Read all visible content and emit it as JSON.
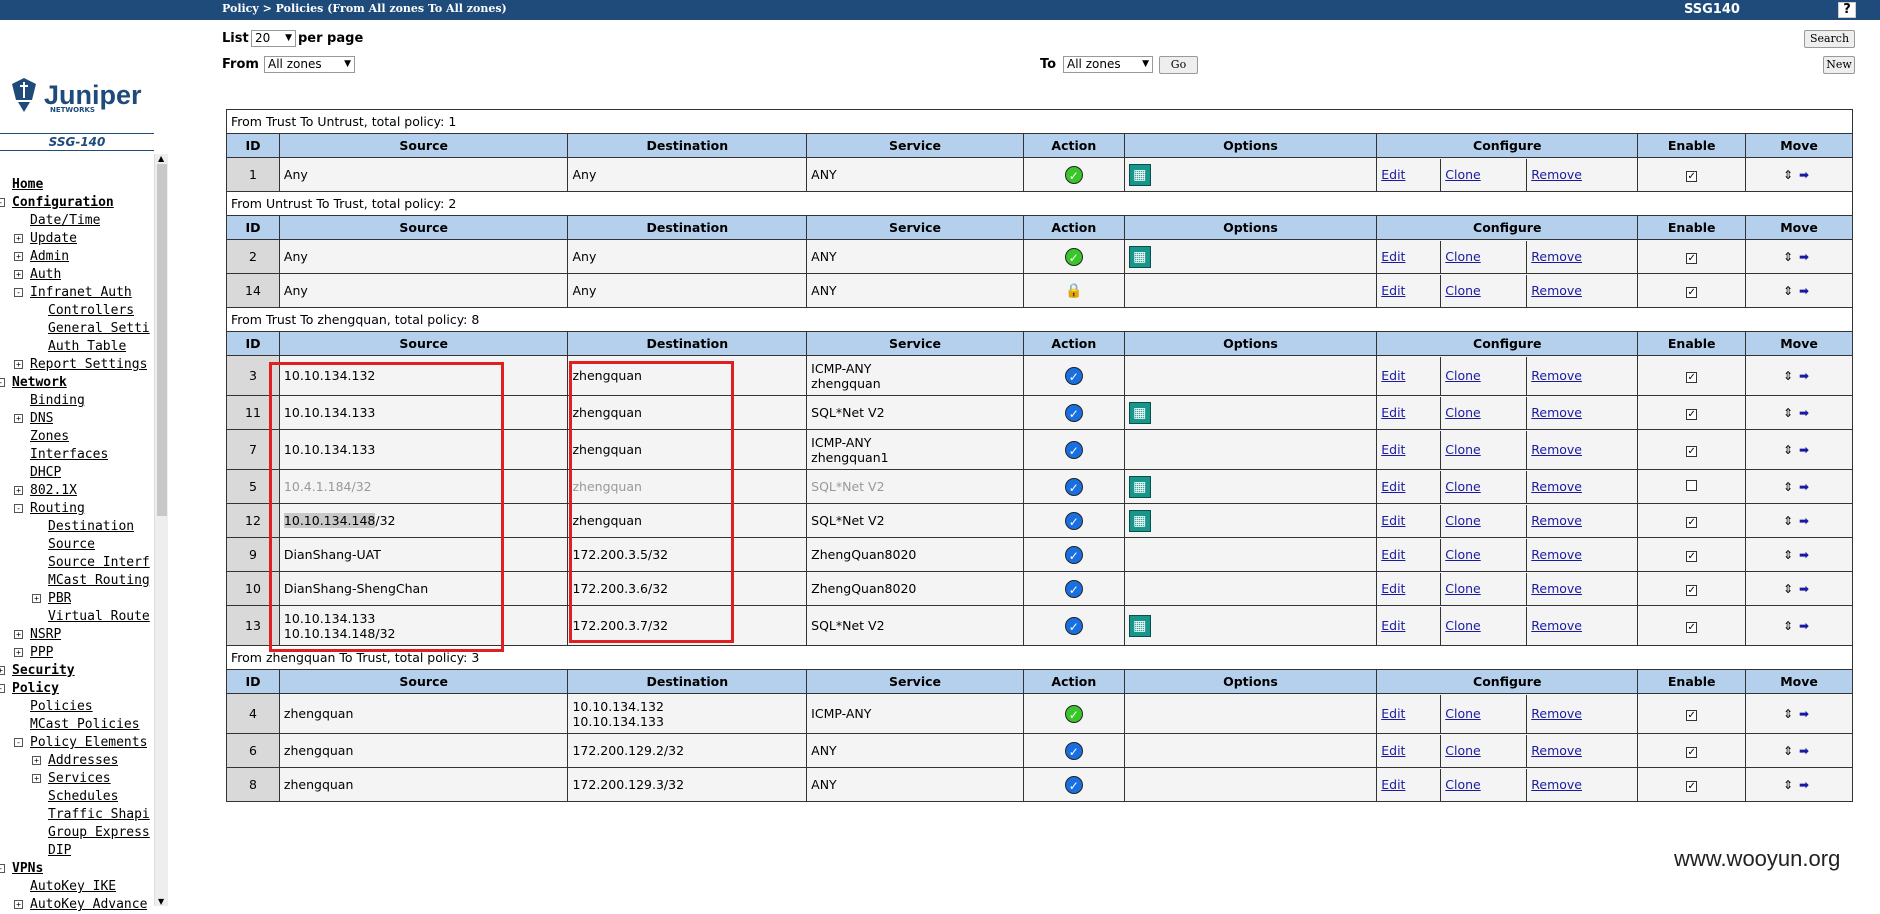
{
  "header": {
    "breadcrumb": "Policy > Policies (From All zones To All zones)",
    "device": "SSG140",
    "help": "?"
  },
  "sidebar": {
    "logo": "Juniper",
    "logo_sub": "NETWORKS",
    "model": "SSG-140",
    "items": [
      {
        "label": "Home",
        "indent": 0,
        "bold": true,
        "toggle": ""
      },
      {
        "label": "Configuration",
        "indent": 0,
        "bold": true,
        "toggle": "-"
      },
      {
        "label": "Date/Time",
        "indent": 1,
        "bold": false,
        "toggle": ""
      },
      {
        "label": "Update",
        "indent": 1,
        "bold": false,
        "toggle": "+"
      },
      {
        "label": "Admin",
        "indent": 1,
        "bold": false,
        "toggle": "+"
      },
      {
        "label": "Auth",
        "indent": 1,
        "bold": false,
        "toggle": "+"
      },
      {
        "label": "Infranet Auth",
        "indent": 1,
        "bold": false,
        "toggle": "-"
      },
      {
        "label": "Controllers",
        "indent": 2,
        "bold": false,
        "toggle": ""
      },
      {
        "label": "General Setti",
        "indent": 2,
        "bold": false,
        "toggle": ""
      },
      {
        "label": "Auth Table",
        "indent": 2,
        "bold": false,
        "toggle": ""
      },
      {
        "label": "Report Settings",
        "indent": 1,
        "bold": false,
        "toggle": "+"
      },
      {
        "label": "Network",
        "indent": 0,
        "bold": true,
        "toggle": "-"
      },
      {
        "label": "Binding",
        "indent": 1,
        "bold": false,
        "toggle": ""
      },
      {
        "label": "DNS",
        "indent": 1,
        "bold": false,
        "toggle": "+"
      },
      {
        "label": "Zones",
        "indent": 1,
        "bold": false,
        "toggle": ""
      },
      {
        "label": "Interfaces",
        "indent": 1,
        "bold": false,
        "toggle": ""
      },
      {
        "label": "DHCP",
        "indent": 1,
        "bold": false,
        "toggle": ""
      },
      {
        "label": "802.1X",
        "indent": 1,
        "bold": false,
        "toggle": "+"
      },
      {
        "label": "Routing",
        "indent": 1,
        "bold": false,
        "toggle": "-"
      },
      {
        "label": "Destination",
        "indent": 2,
        "bold": false,
        "toggle": ""
      },
      {
        "label": "Source",
        "indent": 2,
        "bold": false,
        "toggle": ""
      },
      {
        "label": "Source Interf",
        "indent": 2,
        "bold": false,
        "toggle": ""
      },
      {
        "label": "MCast Routing",
        "indent": 2,
        "bold": false,
        "toggle": ""
      },
      {
        "label": "PBR",
        "indent": 2,
        "bold": false,
        "toggle": "+"
      },
      {
        "label": "Virtual Route",
        "indent": 2,
        "bold": false,
        "toggle": ""
      },
      {
        "label": "NSRP",
        "indent": 1,
        "bold": false,
        "toggle": "+"
      },
      {
        "label": "PPP",
        "indent": 1,
        "bold": false,
        "toggle": "+"
      },
      {
        "label": "Security",
        "indent": 0,
        "bold": true,
        "toggle": "+"
      },
      {
        "label": "Policy",
        "indent": 0,
        "bold": true,
        "toggle": "-"
      },
      {
        "label": "Policies",
        "indent": 1,
        "bold": false,
        "toggle": ""
      },
      {
        "label": "MCast Policies",
        "indent": 1,
        "bold": false,
        "toggle": ""
      },
      {
        "label": "Policy Elements",
        "indent": 1,
        "bold": false,
        "toggle": "-"
      },
      {
        "label": "Addresses",
        "indent": 2,
        "bold": false,
        "toggle": "+"
      },
      {
        "label": "Services",
        "indent": 2,
        "bold": false,
        "toggle": "+"
      },
      {
        "label": "Schedules",
        "indent": 2,
        "bold": false,
        "toggle": ""
      },
      {
        "label": "Traffic Shapi",
        "indent": 2,
        "bold": false,
        "toggle": ""
      },
      {
        "label": "Group Express",
        "indent": 2,
        "bold": false,
        "toggle": ""
      },
      {
        "label": "DIP",
        "indent": 2,
        "bold": false,
        "toggle": ""
      },
      {
        "label": "VPNs",
        "indent": 0,
        "bold": true,
        "toggle": "-"
      },
      {
        "label": "AutoKey IKE",
        "indent": 1,
        "bold": false,
        "toggle": ""
      },
      {
        "label": "AutoKey Advance",
        "indent": 1,
        "bold": false,
        "toggle": "+"
      }
    ]
  },
  "toolbar": {
    "list_label": "List",
    "list_value": "20",
    "per_page": "per page",
    "from_label": "From",
    "from_value": "All zones",
    "to_label": "To",
    "to_value": "All zones",
    "go": "Go",
    "search": "Search",
    "new": "New"
  },
  "columns": [
    "ID",
    "Source",
    "Destination",
    "Service",
    "Action",
    "Options",
    "Configure",
    "Enable",
    "Move"
  ],
  "config_links": [
    "Edit",
    "Clone",
    "Remove"
  ],
  "sections": [
    {
      "title": "From Trust To Untrust, total policy: 1",
      "rows": [
        {
          "id": "1",
          "source": [
            "Any"
          ],
          "destination": [
            "Any"
          ],
          "service": [
            "ANY"
          ],
          "action": "permit",
          "options": true,
          "enabled": true,
          "disabled_text": false
        }
      ]
    },
    {
      "title": "From Untrust To Trust, total policy: 2",
      "rows": [
        {
          "id": "2",
          "source": [
            "Any"
          ],
          "destination": [
            "Any"
          ],
          "service": [
            "ANY"
          ],
          "action": "permit",
          "options": true,
          "enabled": true,
          "disabled_text": false
        },
        {
          "id": "14",
          "source": [
            "Any"
          ],
          "destination": [
            "Any"
          ],
          "service": [
            "ANY"
          ],
          "action": "deny",
          "options": false,
          "enabled": true,
          "disabled_text": false
        }
      ]
    },
    {
      "title": "From Trust To zhengquan, total policy: 8",
      "rows": [
        {
          "id": "3",
          "source": [
            "10.10.134.132"
          ],
          "destination": [
            "zhengquan"
          ],
          "service": [
            "ICMP-ANY",
            "zhengquan"
          ],
          "action": "tunnel",
          "options": false,
          "enabled": true,
          "disabled_text": false
        },
        {
          "id": "11",
          "source": [
            "10.10.134.133"
          ],
          "destination": [
            "zhengquan"
          ],
          "service": [
            "SQL*Net V2"
          ],
          "action": "tunnel",
          "options": true,
          "enabled": true,
          "disabled_text": false
        },
        {
          "id": "7",
          "source": [
            "10.10.134.133"
          ],
          "destination": [
            "zhengquan"
          ],
          "service": [
            "ICMP-ANY",
            "zhengquan1"
          ],
          "action": "tunnel",
          "options": false,
          "enabled": true,
          "disabled_text": false
        },
        {
          "id": "5",
          "source": [
            "10.4.1.184/32"
          ],
          "destination": [
            "zhengquan"
          ],
          "service": [
            "SQL*Net V2"
          ],
          "action": "tunnel",
          "options": true,
          "enabled": false,
          "disabled_text": true
        },
        {
          "id": "12",
          "source": [
            "10.10.134.148/32"
          ],
          "destination": [
            "zhengquan"
          ],
          "service": [
            "SQL*Net V2"
          ],
          "action": "tunnel",
          "options": true,
          "enabled": true,
          "disabled_text": false
        },
        {
          "id": "9",
          "source": [
            "DianShang-UAT"
          ],
          "destination": [
            "172.200.3.5/32"
          ],
          "service": [
            "ZhengQuan8020"
          ],
          "action": "tunnel",
          "options": false,
          "enabled": true,
          "disabled_text": false
        },
        {
          "id": "10",
          "source": [
            "DianShang-ShengChan"
          ],
          "destination": [
            "172.200.3.6/32"
          ],
          "service": [
            "ZhengQuan8020"
          ],
          "action": "tunnel",
          "options": false,
          "enabled": true,
          "disabled_text": false
        },
        {
          "id": "13",
          "source": [
            "10.10.134.133",
            "10.10.134.148/32"
          ],
          "destination": [
            "172.200.3.7/32"
          ],
          "service": [
            "SQL*Net V2"
          ],
          "action": "tunnel",
          "options": true,
          "enabled": true,
          "disabled_text": false
        }
      ]
    },
    {
      "title": "From zhengquan To Trust, total policy: 3",
      "rows": [
        {
          "id": "4",
          "source": [
            "zhengquan"
          ],
          "destination": [
            "10.10.134.132",
            "10.10.134.133"
          ],
          "service": [
            "ICMP-ANY"
          ],
          "action": "permit",
          "options": false,
          "enabled": true,
          "disabled_text": false
        },
        {
          "id": "6",
          "source": [
            "zhengquan"
          ],
          "destination": [
            "172.200.129.2/32"
          ],
          "service": [
            "ANY"
          ],
          "action": "tunnel",
          "options": false,
          "enabled": true,
          "disabled_text": false
        },
        {
          "id": "8",
          "source": [
            "zhengquan"
          ],
          "destination": [
            "172.200.129.3/32"
          ],
          "service": [
            "ANY"
          ],
          "action": "tunnel",
          "options": false,
          "enabled": true,
          "disabled_text": false
        }
      ]
    }
  ],
  "watermark": "www.wooyun.org",
  "colors": {
    "topbar": "#1e4b7a",
    "header_row": "#b5d0ec",
    "highlight_box": "#e02020"
  }
}
